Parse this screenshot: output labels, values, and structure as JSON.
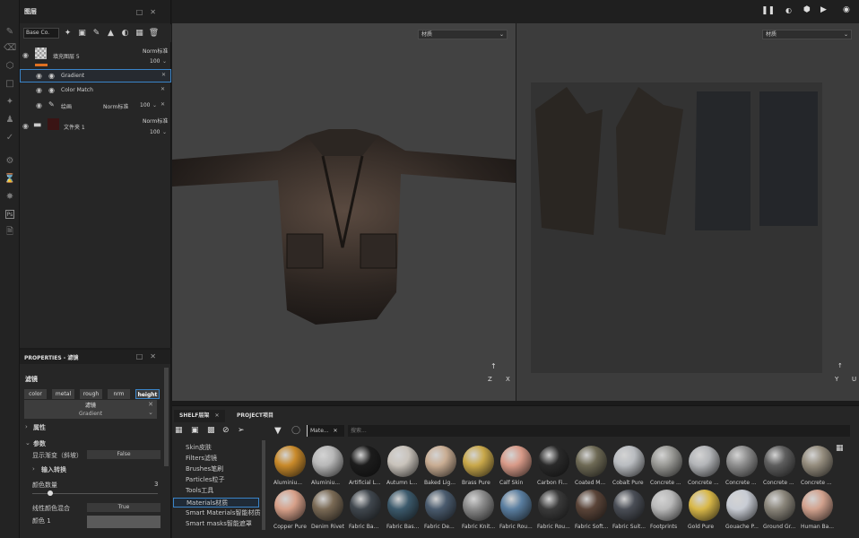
{
  "layers_panel": {
    "title": "图层",
    "blend_select": "Base Co.",
    "layers": [
      {
        "name": "填充图层 5",
        "blend": "Norm标准",
        "opacity": "100"
      },
      {
        "name": "Gradient",
        "selected": true
      },
      {
        "name": "Color Match"
      },
      {
        "name": "绘画",
        "blend": "Norm标准",
        "opacity": "100"
      },
      {
        "name": "文件夹 1",
        "blend": "Norm标准",
        "opacity": "100"
      }
    ]
  },
  "properties": {
    "title": "PROPERTIES - 滤镜",
    "section": "滤镜",
    "channels": [
      "color",
      "metal",
      "rough",
      "nrm",
      "height"
    ],
    "filter_label": "滤镜",
    "filter_value": "Gradient",
    "attr_label": "属性",
    "params_label": "参数",
    "preview_label": "显示渐变（斜坡）",
    "preview_value": "False",
    "input_label": "输入转换",
    "color_count_label": "颜色数量",
    "color_count_value": "3",
    "linear_label": "线性颜色混合",
    "linear_value": "True",
    "color1_label": "颜色 1"
  },
  "viewports": {
    "left_select": "材质",
    "right_select": "材质",
    "axis_z": "Z",
    "axis_x": "X",
    "axis_y": "Y",
    "axis_u": "U"
  },
  "shelf": {
    "tab_shelf": "SHELF层架",
    "tab_project": "PROJECT项目",
    "filter_chip": "Mate...",
    "search_placeholder": "搜索...",
    "categories": [
      "Skin皮肤",
      "Filters滤镜",
      "Brushes笔刷",
      "Particles粒子",
      "Tools工具",
      "Materials材质",
      "Smart Materials智能材质",
      "Smart masks智能遮罩"
    ],
    "selected_category": "Materials材质",
    "materials": [
      {
        "label": "Aluminiu...",
        "color": "#c98a2a"
      },
      {
        "label": "Aluminiu...",
        "color": "#b8b8b8"
      },
      {
        "label": "Artificial L...",
        "color": "#1c1c1c"
      },
      {
        "label": "Autumn L...",
        "color": "#c9c3bb"
      },
      {
        "label": "Baked Lig...",
        "color": "#c9ad93"
      },
      {
        "label": "Brass Pure",
        "color": "#c9a84a"
      },
      {
        "label": "Calf Skin",
        "color": "#d89a88"
      },
      {
        "label": "Carbon Fi...",
        "color": "#2a2a2a"
      },
      {
        "label": "Coated M...",
        "color": "#6e6a55"
      },
      {
        "label": "Cobalt Pure",
        "color": "#b9bcc0"
      },
      {
        "label": "Concrete ...",
        "color": "#9a9a96"
      },
      {
        "label": "Concrete ...",
        "color": "#b3b5b8"
      },
      {
        "label": "Concrete ...",
        "color": "#8e8e8e"
      },
      {
        "label": "Concrete ...",
        "color": "#5e5e5e"
      },
      {
        "label": "Concrete ...",
        "color": "#958d7e"
      },
      {
        "label": "Copper Pure",
        "color": "#d7a089"
      },
      {
        "label": "Denim Rivet",
        "color": "#7a6a55"
      },
      {
        "label": "Fabric Ba...",
        "color": "#40474e"
      },
      {
        "label": "Fabric Bas...",
        "color": "#3c5a6c"
      },
      {
        "label": "Fabric De...",
        "color": "#4a5b6e"
      },
      {
        "label": "Fabric Knit...",
        "color": "#8a8a8a"
      },
      {
        "label": "Fabric Rou...",
        "color": "#5a7ea0"
      },
      {
        "label": "Fabric Rou...",
        "color": "#3a3a3a"
      },
      {
        "label": "Fabric Soft...",
        "color": "#5a4438"
      },
      {
        "label": "Fabric Suit...",
        "color": "#4a4e56"
      },
      {
        "label": "Footprints",
        "color": "#b9b9b9"
      },
      {
        "label": "Gold Pure",
        "color": "#d9b848"
      },
      {
        "label": "Gouache P...",
        "color": "#c8ccd4"
      },
      {
        "label": "Ground Gr...",
        "color": "#8a857a"
      },
      {
        "label": "Human Ba...",
        "color": "#d2a28e"
      }
    ]
  }
}
